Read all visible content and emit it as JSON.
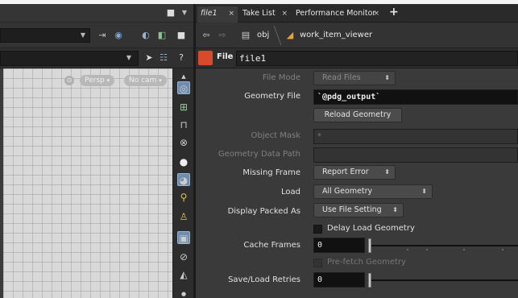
{
  "tabs": [
    {
      "label": "file1",
      "active": true
    },
    {
      "label": "Take List",
      "active": false
    },
    {
      "label": "Performance Monitor",
      "active": false
    }
  ],
  "navbar": {
    "path": [
      "obj",
      "work_item_viewer"
    ]
  },
  "viewport": {
    "camera_mode": "Persp",
    "camera_select": "No cam"
  },
  "node": {
    "type": "File",
    "name": "file1"
  },
  "params": {
    "file_mode": {
      "label": "File Mode",
      "value": "Read Files"
    },
    "geometry_file": {
      "label": "Geometry File",
      "value": "`@pdg_output`"
    },
    "reload_geometry": "Reload Geometry",
    "object_mask": {
      "label": "Object Mask",
      "value": "*"
    },
    "geometry_data_path": {
      "label": "Geometry Data Path",
      "value": ""
    },
    "missing_frame": {
      "label": "Missing Frame",
      "value": "Report Error"
    },
    "load": {
      "label": "Load",
      "value": "All Geometry"
    },
    "display_packed_as": {
      "label": "Display Packed As",
      "value": "Use File Setting"
    },
    "delay_load": "Delay Load Geometry",
    "cache_frames": {
      "label": "Cache Frames",
      "value": "0"
    },
    "prefetch": "Pre-fetch Geometry",
    "save_load_retries": {
      "label": "Save/Load Retries",
      "value": "0"
    }
  },
  "colors": {
    "node_icon": "#d94a2a",
    "selection": "#6e8cad"
  }
}
